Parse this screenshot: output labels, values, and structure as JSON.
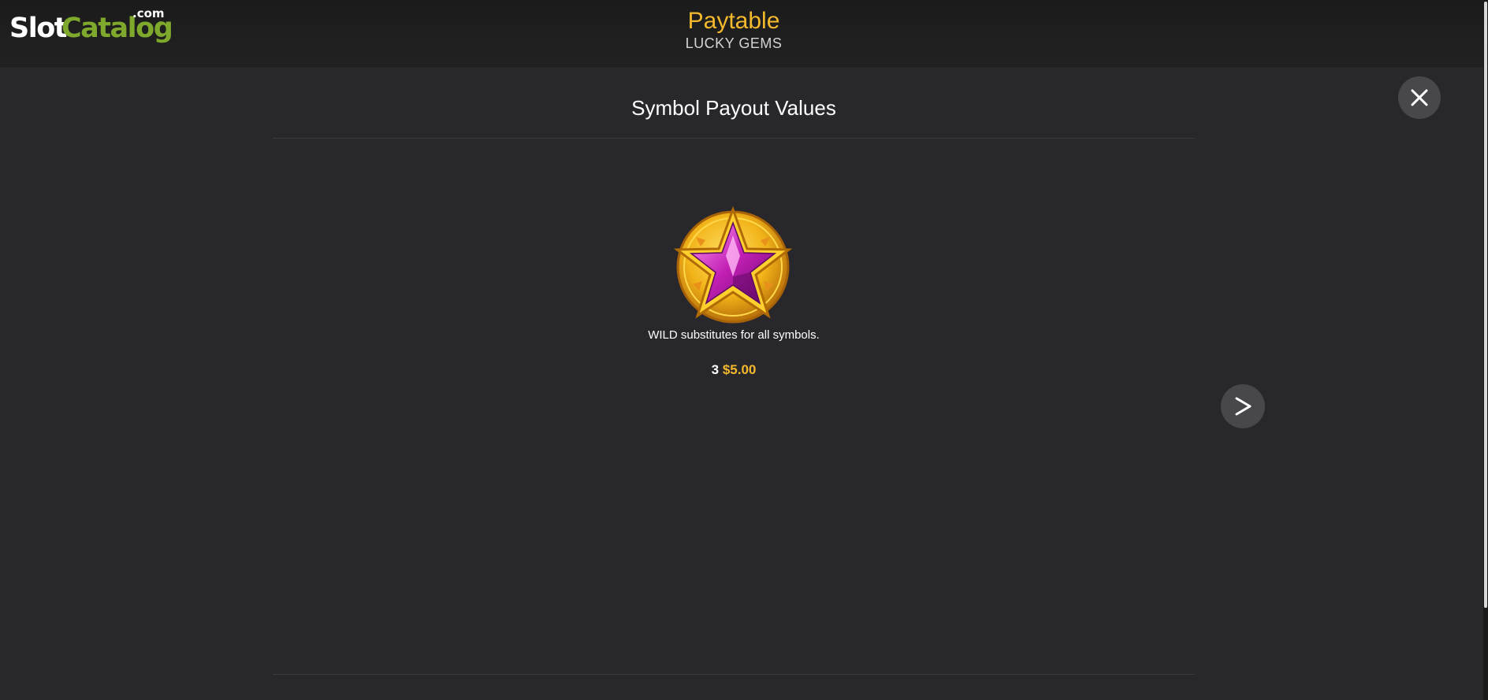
{
  "header": {
    "logo": {
      "slot": "Slot",
      "catalog": "Catalog",
      "com": ".com"
    },
    "title": "Paytable",
    "subtitle": "LUCKY GEMS"
  },
  "content": {
    "section_title": "Symbol Payout Values",
    "symbol": {
      "icon": "wild-star-gem-icon",
      "description": "WILD substitutes for all symbols.",
      "payouts": [
        {
          "count": "3",
          "value": "$5.00"
        }
      ]
    }
  },
  "controls": {
    "close_icon": "close-icon",
    "next_icon": "chevron-right-icon"
  },
  "colors": {
    "background": "#28272b",
    "header_background": "#1b1b1b",
    "accent_gold": "#f4b92c",
    "logo_green": "#7ea92c",
    "button_background": "#48474c"
  }
}
